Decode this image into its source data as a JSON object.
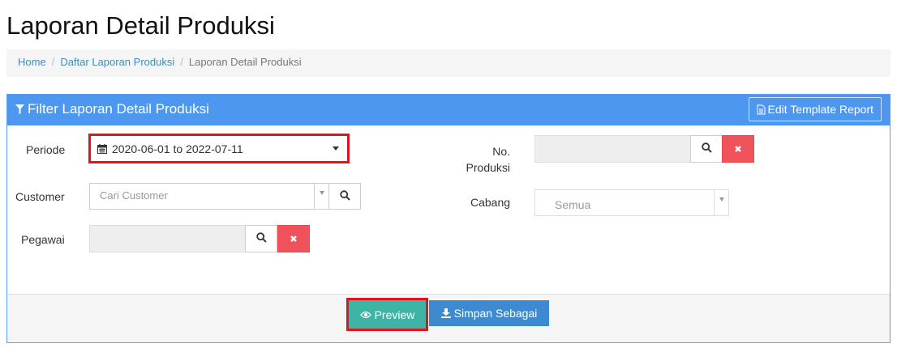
{
  "page": {
    "title": "Laporan Detail Produksi"
  },
  "breadcrumb": {
    "items": [
      {
        "label": "Home"
      },
      {
        "label": "Daftar Laporan Produksi"
      },
      {
        "label": "Laporan Detail Produksi"
      }
    ],
    "separator": "/"
  },
  "panel": {
    "title": "Filter Laporan Detail Produksi",
    "edit_template_label": "Edit Template Report",
    "heading_color": "#4d97f0"
  },
  "filters": {
    "periode": {
      "label": "Periode",
      "value": "2020-06-01 to 2022-07-11"
    },
    "customer": {
      "label": "Customer",
      "placeholder": "Cari Customer"
    },
    "pegawai": {
      "label": "Pegawai",
      "value": ""
    },
    "no_produksi": {
      "label_line1": "No.",
      "label_line2": "Produksi",
      "value": ""
    },
    "cabang": {
      "label": "Cabang",
      "value": "Semua"
    }
  },
  "footer": {
    "preview_label": "Preview",
    "save_as_label": "Simpan Sebagai",
    "preview_color": "#3fb3a6",
    "save_color": "#3e8ad0"
  },
  "icons": {
    "filter": "filter-icon",
    "edit": "file-text-icon",
    "calendar": "calendar-icon",
    "search": "search-icon",
    "clear": "times-icon",
    "eye": "eye-icon",
    "download": "download-icon"
  }
}
